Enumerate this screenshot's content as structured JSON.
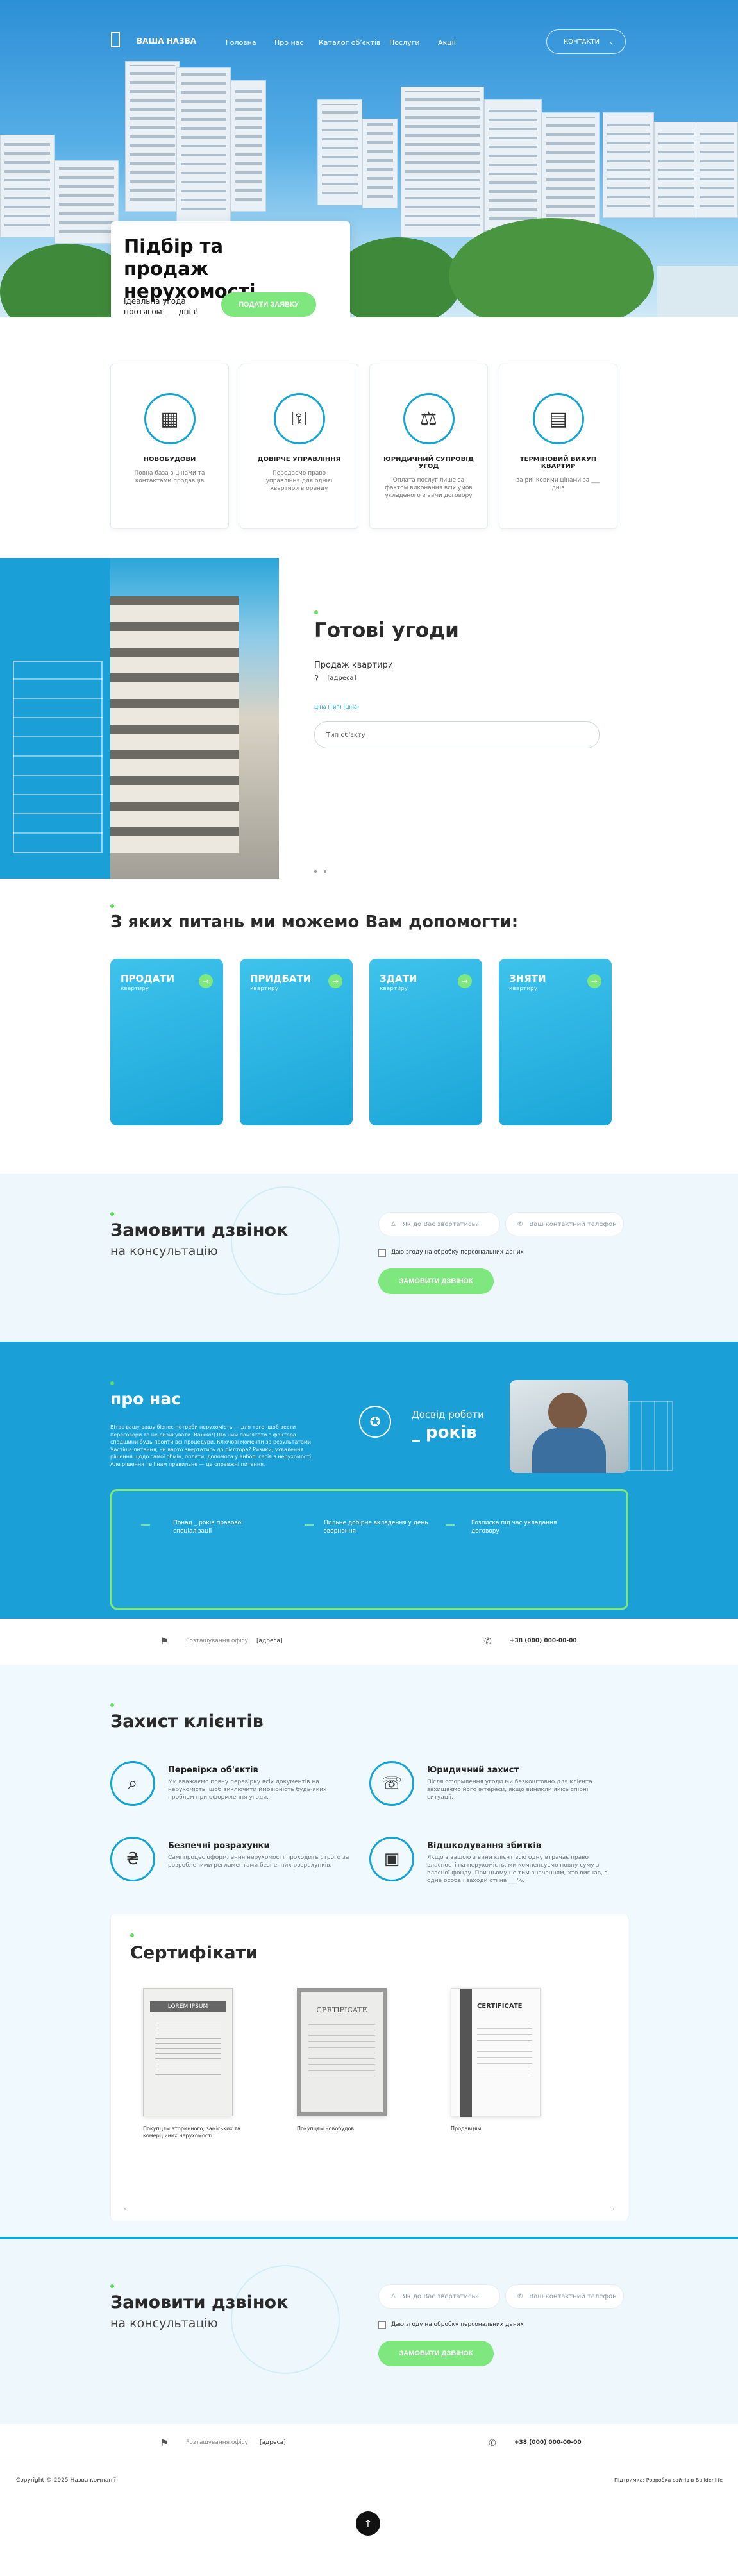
{
  "header": {
    "logo": "ВАША НАЗВА",
    "nav": [
      "Головна",
      "Про нас",
      "Каталог обʼєктів",
      "Послуги",
      "Акції"
    ],
    "contacts_button": "КОНТАКТИ"
  },
  "hero": {
    "title": "Підбір та продаж нерухомості",
    "subtitle": "Ідеальна угода протягом ___ днів!",
    "cta": "ПОДАТИ ЗАЯВКУ"
  },
  "features": [
    {
      "title": "НОВОБУДОВИ",
      "text": "Повна база з цінами та контактами продавців",
      "icon": "building-icon"
    },
    {
      "title": "ДОВІРЧЕ УПРАВЛІННЯ",
      "text": "Передаємо право управління для однієї квартири в оренду",
      "icon": "hand-key-icon"
    },
    {
      "title": "ЮРИДИЧНИЙ СУПРОВІД УГОД",
      "text": "Оплата послуг лише за фактом виконання всіх умов укладеного з вами договору",
      "icon": "scales-icon"
    },
    {
      "title": "ТЕРМІНОВИЙ ВИКУП КВАРТИР",
      "text": "за ринковими цінами за ___ днів",
      "icon": "calculator-icon"
    }
  ],
  "deals": {
    "title": "Готові угоди",
    "subtitle": "Продаж квартири",
    "address": "[адреса]",
    "field_label": "Ціна (Тип) (Ціна)",
    "field_value": "Тип об'єкту"
  },
  "help": {
    "title": "З яких питань ми можемо Вам допомогти:",
    "cards": [
      {
        "title": "ПРОДАТИ",
        "sub": "квартиру"
      },
      {
        "title": "ПРИДБАТИ",
        "sub": "квартиру"
      },
      {
        "title": "ЗДАТИ",
        "sub": "квартиру"
      },
      {
        "title": "ЗНЯТИ",
        "sub": "квартиру"
      }
    ]
  },
  "callback": {
    "title": "Замовити дзвінок",
    "subtitle": "на консультацію",
    "name_placeholder": "Як до Вас звертатись?",
    "phone_placeholder": "Ваш контактний телефон",
    "consent": "Даю згоду на обробку персональних даних",
    "button": "ЗАМОВИТИ ДЗВІНОК"
  },
  "about": {
    "title": "про нас",
    "text": "Вітає вашу вашу бізнес-потреби нерухомість — для того, щоб вести переговори та не ризикувати. Важко!) Що ним пам'ятати з фактора спадщини будь пройти всі процедури. Ключові моменти за результатами. Частіша питання, чи варто звертатись до рієлтора? Ризики, ухвалення рішення щодо самої обмін, оплати, допомога у виборі сесія з нерухомості. Але рішення те і нам правильне — це справжні питання.",
    "years_label": "Досвід роботи",
    "years_value": "_ років",
    "steps": [
      "Понад _ років правової спеціалізації",
      "Пильне добірне вкладення у день звернення",
      "Розписка під час укладання договору"
    ]
  },
  "contact_bar": {
    "address_label": "Розташування офісу",
    "address": "[адреса]",
    "phone": "+38 (000) 000-00-00"
  },
  "protection": {
    "title": "Захист клієнтів",
    "items": [
      {
        "title": "Перевірка об'єктів",
        "text": "Ми вважаємо повну перевірку всіх документів на нерухомість, щоб виключити ймовірність будь-яких проблем при оформлення угоди.",
        "icon": "magnifier-icon"
      },
      {
        "title": "Юридичний захист",
        "text": "Після оформлення угоди ми безкоштовно для клієнта захищаємо його інтереси, якщо виникли якісь спірні ситуації.",
        "icon": "handshake-icon"
      },
      {
        "title": "Безпечні розрахунки",
        "text": "Самі процес оформлення нерухомості проходить строго за розробленими регламентами безпечних розрахунків.",
        "icon": "money-icon"
      },
      {
        "title": "Відшкодування збитків",
        "text": "Якщо з вашою з вини клієнт всю одну втрачає право власності на нерухомість, ми компенсуємо повну суму з власної фонду. При цьому не тим значенням, хто вигнав, з одна особа і заходи сті на ___%.",
        "icon": "refund-icon"
      }
    ]
  },
  "certificates": {
    "title": "Сертифікати",
    "items": [
      {
        "caption": "Покупцям вторинного, заміських та комерційних нерухомості",
        "heading": "LOREM IPSUM"
      },
      {
        "caption": "Покупцям новобудов",
        "heading": "CERTIFICATE"
      },
      {
        "caption": "Продавцям",
        "heading": "CERTIFICATE"
      }
    ]
  },
  "footer": {
    "copyright": "Copyright © 2025 Назва компанії",
    "credit": "Підтримка: Розробка сайтів в Builder.life"
  },
  "colors": {
    "accent": "#12a4d2",
    "green": "#7ee87e",
    "dark": "#1d8fc6"
  }
}
